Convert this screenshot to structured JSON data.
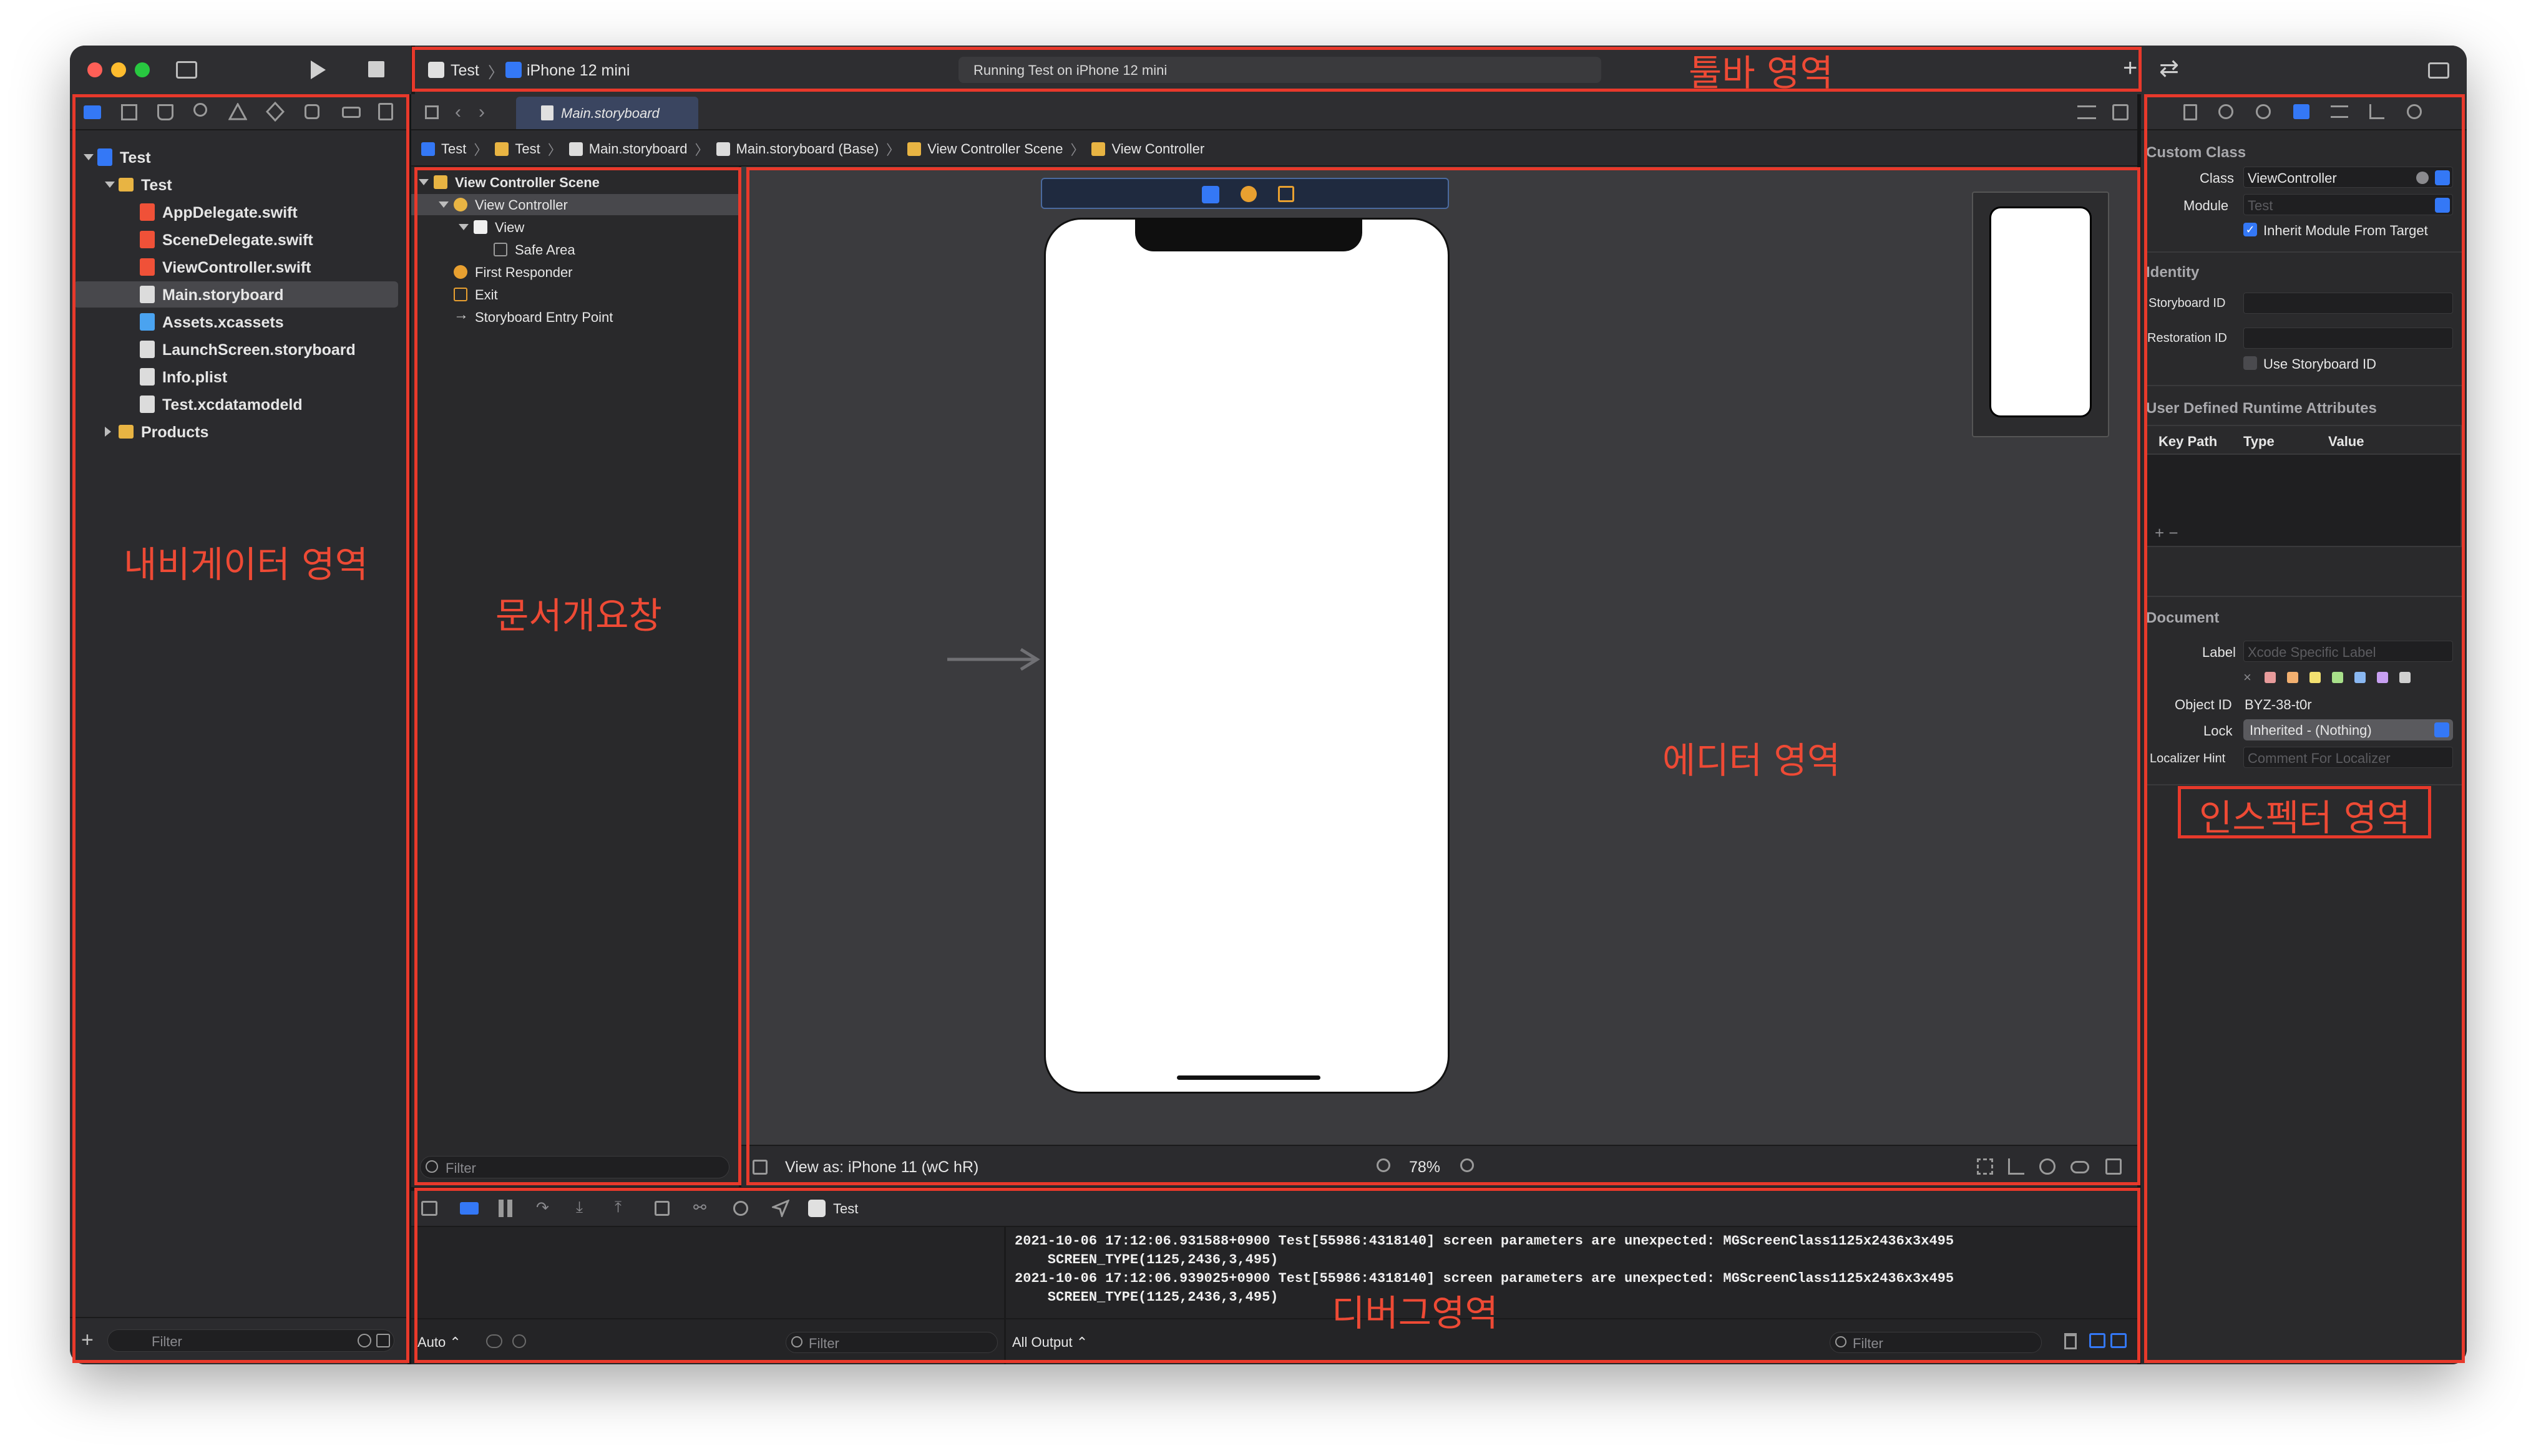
{
  "toolbar": {
    "scheme": "Test",
    "device": "iPhone 12 mini",
    "status": "Running Test on iPhone 12 mini",
    "add_symbol": "+",
    "swap_symbol": "⇄"
  },
  "editor_tab": {
    "label": "Main.storyboard"
  },
  "breadcrumb": [
    "Test",
    "Test",
    "Main.storyboard",
    "Main.storyboard (Base)",
    "View Controller Scene",
    "View Controller"
  ],
  "navigator": {
    "items": [
      {
        "label": "Test",
        "level": 0
      },
      {
        "label": "Test",
        "level": 1
      },
      {
        "label": "AppDelegate.swift",
        "level": 2
      },
      {
        "label": "SceneDelegate.swift",
        "level": 2
      },
      {
        "label": "ViewController.swift",
        "level": 2
      },
      {
        "label": "Main.storyboard",
        "level": 2
      },
      {
        "label": "Assets.xcassets",
        "level": 2
      },
      {
        "label": "LaunchScreen.storyboard",
        "level": 2
      },
      {
        "label": "Info.plist",
        "level": 2
      },
      {
        "label": "Test.xcdatamodeld",
        "level": 2
      },
      {
        "label": "Products",
        "level": 1
      }
    ],
    "filter_placeholder": "Filter",
    "add_symbol": "+"
  },
  "outline": {
    "items": [
      "View Controller Scene",
      "View Controller",
      "View",
      "Safe Area",
      "First Responder",
      "Exit",
      "Storyboard Entry Point"
    ],
    "filter_placeholder": "Filter"
  },
  "editor_bar": {
    "view_as": "View as: iPhone 11 (wC hR)",
    "zoom": "78%"
  },
  "inspector": {
    "custom_class": {
      "header": "Custom Class",
      "class_label": "Class",
      "class_value": "ViewController",
      "module_label": "Module",
      "module_placeholder": "Test",
      "inherit_label": "Inherit Module From Target"
    },
    "identity": {
      "header": "Identity",
      "storyboard_id_label": "Storyboard ID",
      "restoration_id_label": "Restoration ID",
      "use_storyboard_id_label": "Use Storyboard ID"
    },
    "runtime": {
      "header": "User Defined Runtime Attributes",
      "col_keypath": "Key Path",
      "col_type": "Type",
      "col_value": "Value",
      "add_remove": "+  −"
    },
    "document": {
      "header": "Document",
      "label_label": "Label",
      "label_placeholder": "Xcode Specific Label",
      "object_id_label": "Object ID",
      "object_id_value": "BYZ-38-t0r",
      "lock_label": "Lock",
      "lock_value": "Inherited - (Nothing)",
      "localizer_label": "Localizer Hint",
      "localizer_placeholder": "Comment For Localizer",
      "swatch_x": "×"
    }
  },
  "debug": {
    "target": "Test",
    "console_lines": [
      "2021-10-06 17:12:06.931588+0900 Test[55986:4318140] screen parameters are unexpected: MGScreenClass1125x2436x3x495",
      "    SCREEN_TYPE(1125,2436,3,495)",
      "2021-10-06 17:12:06.939025+0900 Test[55986:4318140] screen parameters are unexpected: MGScreenClass1125x2436x3x495",
      "    SCREEN_TYPE(1125,2436,3,495)"
    ],
    "auto_label": "Auto ⌃",
    "all_output_label": "All Output ⌃",
    "filter_placeholder": "Filter"
  },
  "annotations": {
    "toolbar": "툴바 영역",
    "navigator": "내비게이터 영역",
    "outline": "문서개요창",
    "editor": "에디터 영역",
    "inspector": "인스펙터 영역",
    "debug": "디버그영역"
  },
  "colors": {
    "annotation_red": "#e8392b",
    "accent_blue": "#3478f6",
    "folder_yellow": "#e8b443",
    "swift_orange": "#f05138"
  },
  "swatches": [
    "#e89b9b",
    "#f2b070",
    "#f2e070",
    "#a8e08a",
    "#8ab8f2",
    "#c8a0f2",
    "#d0d0d0"
  ]
}
